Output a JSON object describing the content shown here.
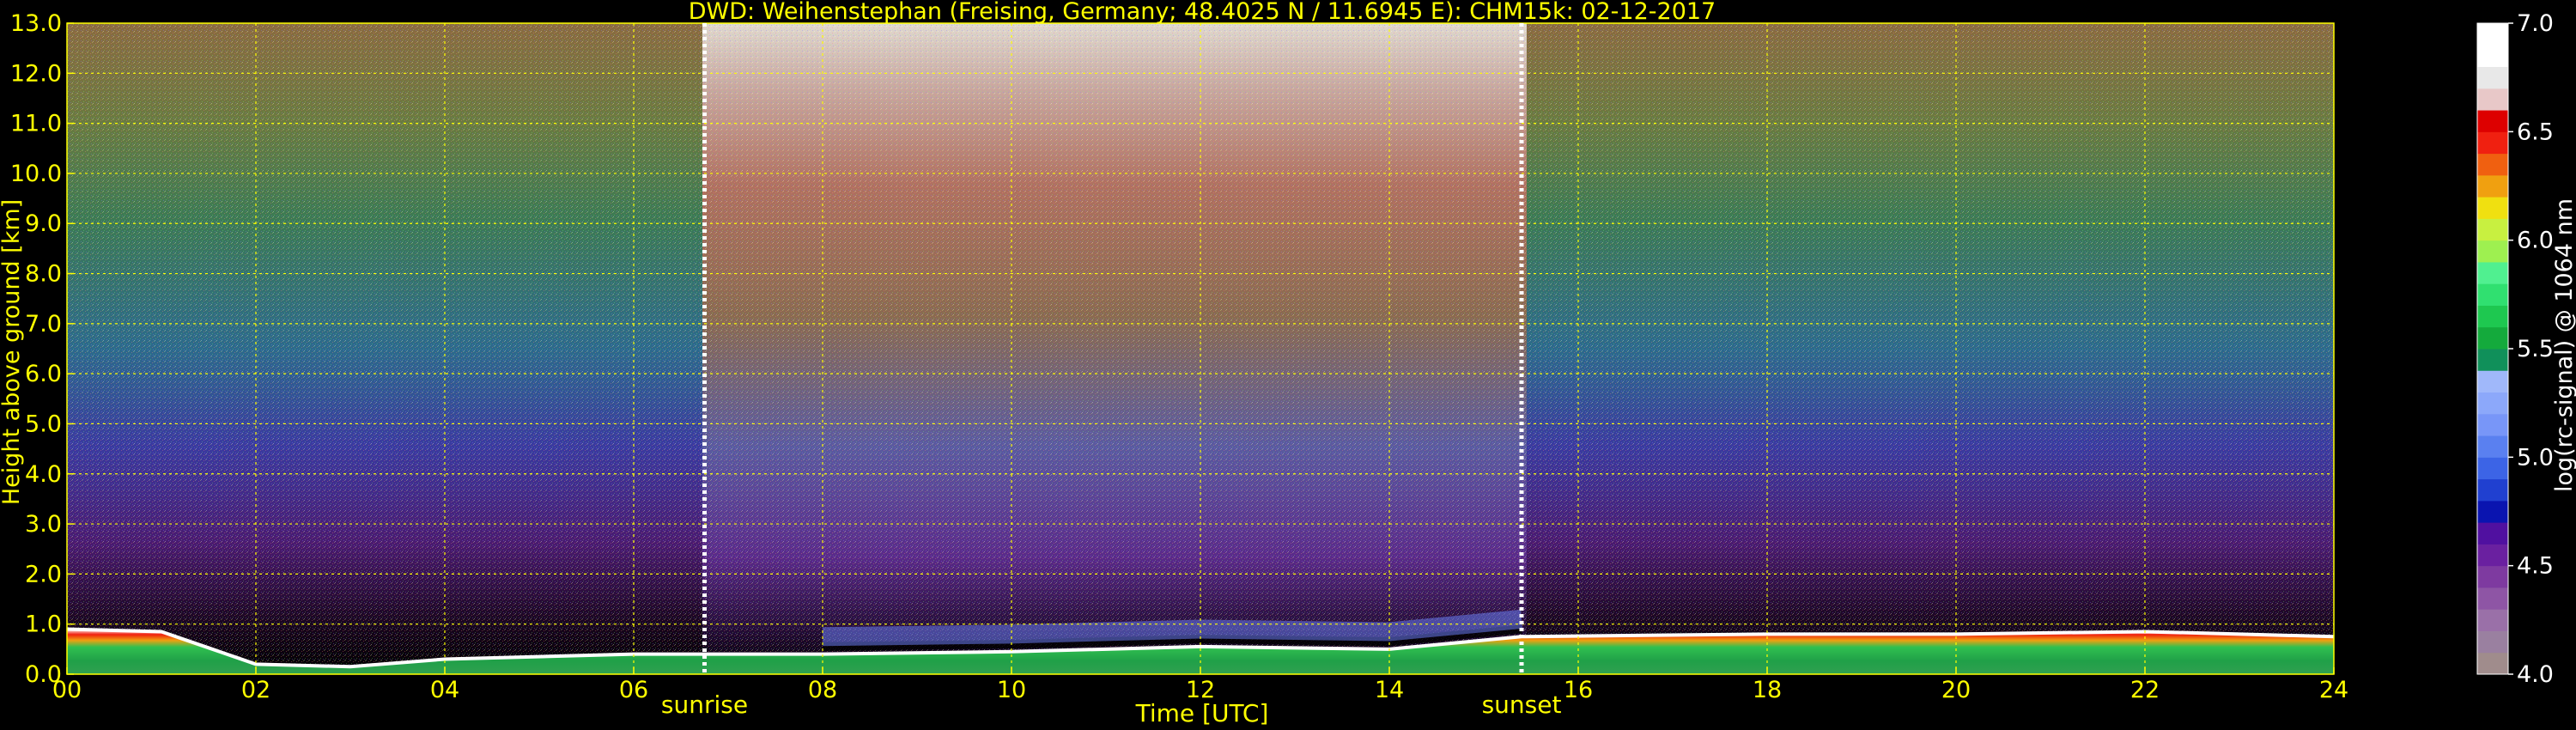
{
  "chart_data": {
    "type": "heatmap",
    "title": "DWD: Weihenstephan (Freising, Germany; 48.4025 N / 11.6945 E):    CHM15k: 02-12-2017",
    "xlabel": "Time [UTC]",
    "ylabel": "Height above ground [km]",
    "x_ticks": [
      "00",
      "02",
      "04",
      "06",
      "08",
      "10",
      "12",
      "14",
      "16",
      "18",
      "20",
      "22",
      "24"
    ],
    "y_ticks": [
      "0.0",
      "1.0",
      "2.0",
      "3.0",
      "4.0",
      "5.0",
      "6.0",
      "7.0",
      "8.0",
      "9.0",
      "10.0",
      "11.0",
      "12.0",
      "13.0"
    ],
    "xlim": [
      0,
      24
    ],
    "ylim": [
      0,
      13
    ],
    "grid": true,
    "annotations": [
      {
        "text": "sunrise",
        "x": 6.75
      },
      {
        "text": "sunset",
        "x": 15.4
      }
    ],
    "colorbar": {
      "label": "log(rc-signal) @ 1064 nm",
      "range": [
        4.0,
        7.0
      ],
      "ticks": [
        "4.0",
        "4.5",
        "5.0",
        "5.5",
        "6.0",
        "6.5",
        "7.0"
      ],
      "colors": [
        "#a08c8c",
        "#9a80a0",
        "#9a70a8",
        "#8e55a5",
        "#7e3aa0",
        "#6a20a0",
        "#5010a0",
        "#0a14b0",
        "#2040d0",
        "#3c64e6",
        "#5a80f0",
        "#7896f8",
        "#8ca8fa",
        "#a0b8fa",
        "#10905a",
        "#14aa3c",
        "#1ec850",
        "#30e070",
        "#50f090",
        "#9ef050",
        "#c8f040",
        "#f0e010",
        "#f0a010",
        "#f06010",
        "#f02010",
        "#dd0000",
        "#e8c8c8",
        "#e8e8e8",
        "#ffffff",
        "#ffffff"
      ]
    },
    "lowest_cloud_layer_km": [
      {
        "x": 0.0,
        "y": 0.9
      },
      {
        "x": 1.0,
        "y": 0.85
      },
      {
        "x": 2.0,
        "y": 0.2
      },
      {
        "x": 3.0,
        "y": 0.15
      },
      {
        "x": 4.0,
        "y": 0.3
      },
      {
        "x": 6.0,
        "y": 0.4
      },
      {
        "x": 8.0,
        "y": 0.4
      },
      {
        "x": 10.0,
        "y": 0.45
      },
      {
        "x": 12.0,
        "y": 0.55
      },
      {
        "x": 14.0,
        "y": 0.5
      },
      {
        "x": 15.4,
        "y": 0.75
      },
      {
        "x": 18.0,
        "y": 0.8
      },
      {
        "x": 20.0,
        "y": 0.8
      },
      {
        "x": 22.0,
        "y": 0.85
      },
      {
        "x": 24.0,
        "y": 0.75
      }
    ]
  }
}
